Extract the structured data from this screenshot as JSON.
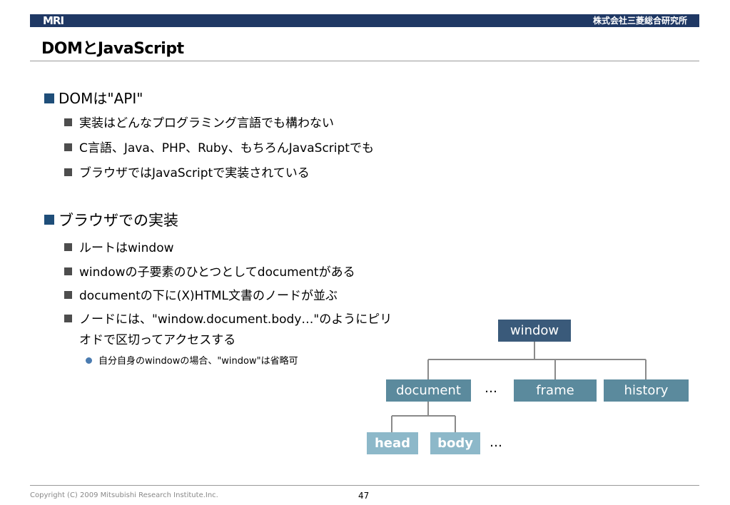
{
  "header": {
    "logo": "MRI",
    "company": "株式会社三菱総合研究所"
  },
  "slide": {
    "title": "DOMとJavaScript",
    "bullets": [
      {
        "text": "DOMは\"API\""
      },
      {
        "text": "実装はどんなプログラミング言語でも構わない"
      },
      {
        "text": "C言語、Java、PHP、Ruby、もちろんJavaScriptでも"
      },
      {
        "text": "ブラウザではJavaScriptで実装されている"
      },
      {
        "text": "ブラウザでの実装"
      },
      {
        "text": "ルートはwindow"
      },
      {
        "text": "windowの子要素のひとつとしてdocumentがある"
      },
      {
        "text": "documentの下に(X)HTML文書のノードが並ぶ"
      },
      {
        "text": "ノードには、\"window.document.body…\"のようにピリ"
      },
      {
        "text": "オドで区切ってアクセスする"
      },
      {
        "text": "自分自身のwindowの場合、\"window\"は省略可"
      }
    ]
  },
  "diagram": {
    "window": "window",
    "document": "document",
    "frame": "frame",
    "history": "history",
    "head": "head",
    "body": "body",
    "ellipsis_1": "…",
    "ellipsis_2": "…"
  },
  "colors": {
    "header_bar": "#1f3864",
    "box_dark": "#3a5a7a",
    "box_mid": "#5b8a9d",
    "box_light": "#8db8c9"
  },
  "footer": {
    "copyright": "Copyright (C) 2009 Mitsubishi Research Institute.Inc.",
    "page": "47"
  }
}
